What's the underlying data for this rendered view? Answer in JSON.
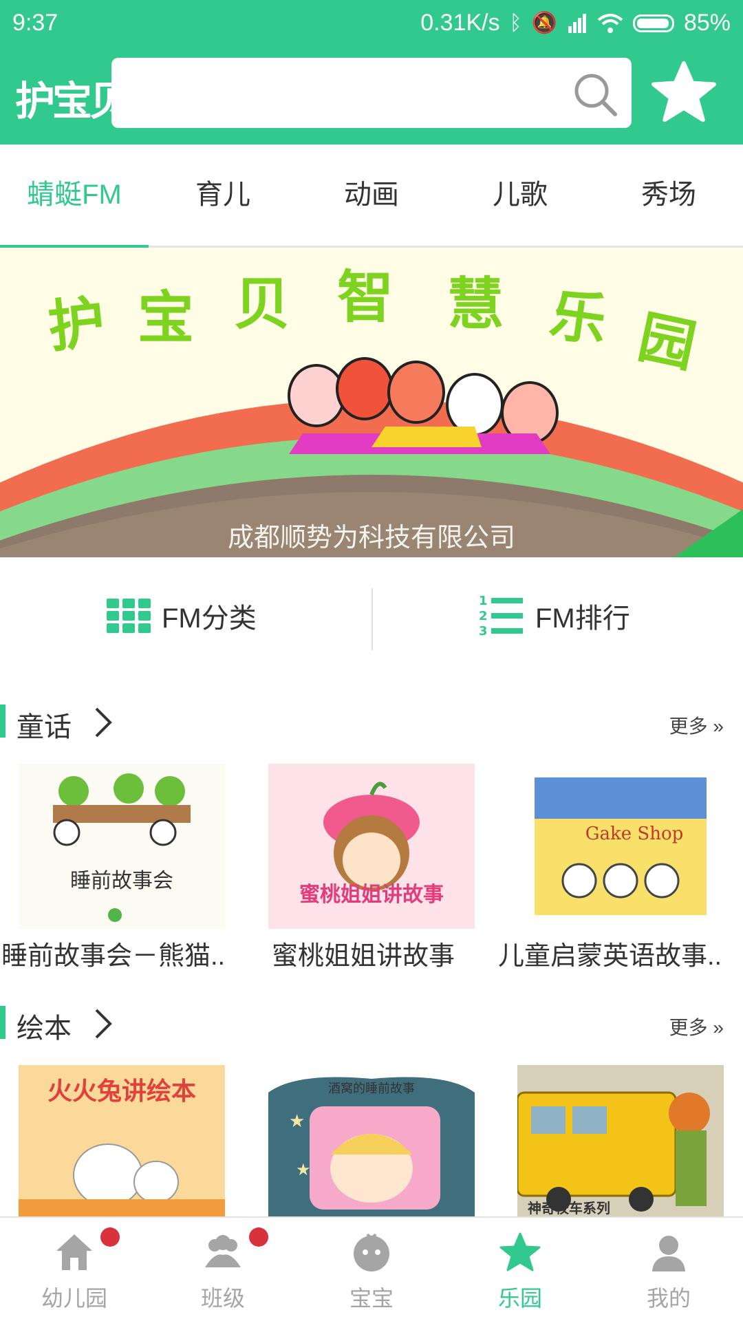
{
  "status_bar": {
    "time": "9:37",
    "speed": "0.31K/s",
    "battery": "85%"
  },
  "header": {
    "logo": "护宝贝",
    "search_placeholder": ""
  },
  "tabs": [
    {
      "label": "蜻蜓FM",
      "active": true
    },
    {
      "label": "育儿"
    },
    {
      "label": "动画"
    },
    {
      "label": "儿歌"
    },
    {
      "label": "秀场"
    }
  ],
  "banner": {
    "title": "护宝贝智慧乐园",
    "company": "成都顺势为科技有限公司"
  },
  "fm": {
    "category": "FM分类",
    "ranking": "FM排行"
  },
  "sections": [
    {
      "title": "童话",
      "more": "更多 »",
      "items": [
        {
          "title": "睡前故事会－熊猫..",
          "thumb_text": "睡前故事会"
        },
        {
          "title": "蜜桃姐姐讲故事",
          "thumb_text": "蜜桃姐姐讲故事"
        },
        {
          "title": "儿童启蒙英语故事..",
          "thumb_text": "Gake Shop"
        }
      ]
    },
    {
      "title": "绘本",
      "more": "更多 »",
      "items": [
        {
          "thumb_text": "火火兔讲绘本"
        },
        {
          "thumb_text": "酒窝的睡前故事"
        },
        {
          "thumb_text": "神奇校车系列"
        }
      ]
    }
  ],
  "bottom_nav": [
    {
      "label": "幼儿园",
      "icon": "home-icon",
      "badge": true
    },
    {
      "label": "班级",
      "icon": "group-icon",
      "badge": true
    },
    {
      "label": "宝宝",
      "icon": "baby-icon"
    },
    {
      "label": "乐园",
      "icon": "star-icon",
      "active": true
    },
    {
      "label": "我的",
      "icon": "user-icon"
    }
  ],
  "colors": {
    "accent": "#31c98d",
    "badge": "#d9313d",
    "inactive": "#a5a5a5"
  }
}
